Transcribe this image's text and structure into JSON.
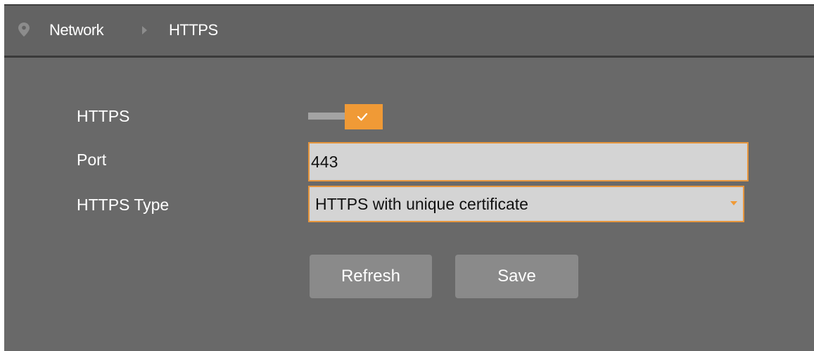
{
  "breadcrumb": {
    "icon": "location-pin-icon",
    "items": [
      "Network",
      "HTTPS"
    ],
    "separator_icon": "chevron-right-icon"
  },
  "form": {
    "https": {
      "label": "HTTPS",
      "enabled": true,
      "check_icon": "checkmark-icon"
    },
    "port": {
      "label": "Port",
      "value": "443"
    },
    "https_type": {
      "label": "HTTPS Type",
      "selected": "HTTPS with unique certificate",
      "caret_icon": "dropdown-caret-icon"
    }
  },
  "buttons": {
    "refresh": "Refresh",
    "save": "Save"
  },
  "colors": {
    "panel": "#696969",
    "header": "#636363",
    "accent": "#f09a36",
    "input_bg": "#d4d4d4",
    "button_bg": "#8a8a8a"
  }
}
